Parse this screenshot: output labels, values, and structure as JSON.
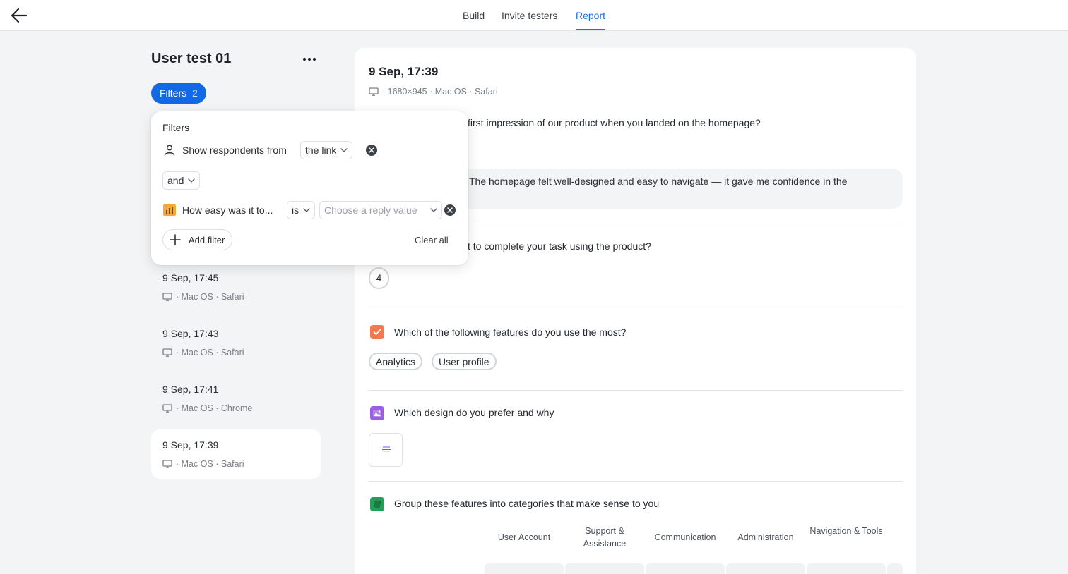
{
  "header": {
    "tabs": [
      {
        "label": "Build"
      },
      {
        "label": "Invite testers"
      },
      {
        "label": "Report"
      }
    ],
    "active_tab": "Report"
  },
  "sidebar": {
    "title": "User test 01",
    "filters_button": {
      "label": "Filters",
      "count": "2"
    },
    "responses": [
      {
        "date": "9 Sep, 17:45",
        "meta": "· Mac OS · Safari"
      },
      {
        "date": "9 Sep, 17:43",
        "meta": "· Mac OS · Safari"
      },
      {
        "date": "9 Sep, 17:41",
        "meta": "· Mac OS · Chrome"
      },
      {
        "date": "9 Sep, 17:39",
        "meta": "· Mac OS · Safari"
      }
    ]
  },
  "filter_popover": {
    "title": "Filters",
    "row1": {
      "label": "Show respondents from",
      "value": "the link"
    },
    "conjunction": "and",
    "row2": {
      "label": "How easy was it to...",
      "operator": "is",
      "placeholder": "Choose a reply value"
    },
    "add_filter": "Add filter",
    "clear_all": "Clear all"
  },
  "detail": {
    "date": "9 Sep, 17:39",
    "meta": "· 1680×945 · Mac OS · Safari",
    "q1": {
      "text": "first impression of our product when you landed on the homepage?",
      "answer": "The homepage felt well-designed and easy to navigate — it gave me confidence in the"
    },
    "q2": {
      "text": "t to complete your task using the product?",
      "rating": "4"
    },
    "q3": {
      "text": "Which of the following features do you use the most?",
      "choices": [
        "Analytics",
        "User profile"
      ]
    },
    "q4": {
      "text": "Which design do you prefer and why"
    },
    "q5": {
      "text": "Group these features into categories that make sense to you",
      "categories": [
        "User Account",
        "Support & Assistance",
        "Communication",
        "Administration",
        "Navigation & Tools"
      ]
    }
  },
  "colors": {
    "accent": "#1a73e8",
    "filters_button": "#1269e6",
    "checkbox_icon": "#f27a4d",
    "image_icon": "#9b5de5",
    "card_sort_icon": "#22a05a",
    "rating_icon": "#f2a93b"
  }
}
